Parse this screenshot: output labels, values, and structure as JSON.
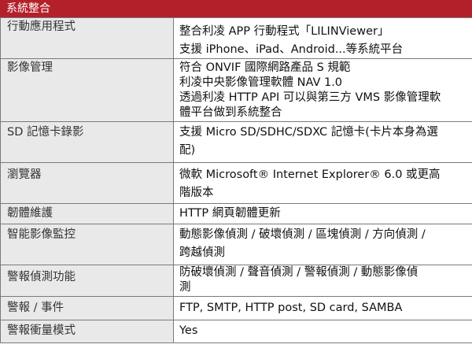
{
  "section_title": "系統整合",
  "rows": [
    {
      "label": "行動應用程式",
      "lines": [
        "整合利凌 APP 行動程式「LILINViewer」",
        "支援 iPhone、iPad、Android...等系統平台"
      ]
    },
    {
      "label": "影像管理",
      "lines": [
        "符合 ONVIF 國際網路產品 S 規範",
        "利凌中央影像管理軟體 NAV 1.0",
        "透過利凌 HTTP API 可以與第三方 VMS 影像管理軟",
        "體平台做到系統整合"
      ]
    },
    {
      "label": "SD 記憶卡錄影",
      "lines": [
        "支援 Micro SD/SDHC/SDXC 記憶卡(卡片本身為選",
        "配)"
      ]
    },
    {
      "label": "瀏覽器",
      "lines": [
        "微軟 Microsoft® Internet Explorer® 6.0 或更高",
        "階版本"
      ]
    },
    {
      "label": "韌體維護",
      "lines": [
        "HTTP 網頁韌體更新"
      ]
    },
    {
      "label": "智能影像監控",
      "lines": [
        "動態影像偵測 / 破壞偵測 / 區塊偵測 / 方向偵測 /",
        "跨越偵測"
      ]
    },
    {
      "label": "警報偵測功能",
      "lines": [
        "防破壞偵測 / 聲音偵測 / 警報偵測 / 動態影像偵",
        "測"
      ]
    },
    {
      "label": "警報 / 事件",
      "lines": [
        "FTP, SMTP, HTTP post, SD card, SAMBA"
      ]
    },
    {
      "label": "警報衝量模式",
      "lines": [
        "Yes"
      ]
    }
  ]
}
